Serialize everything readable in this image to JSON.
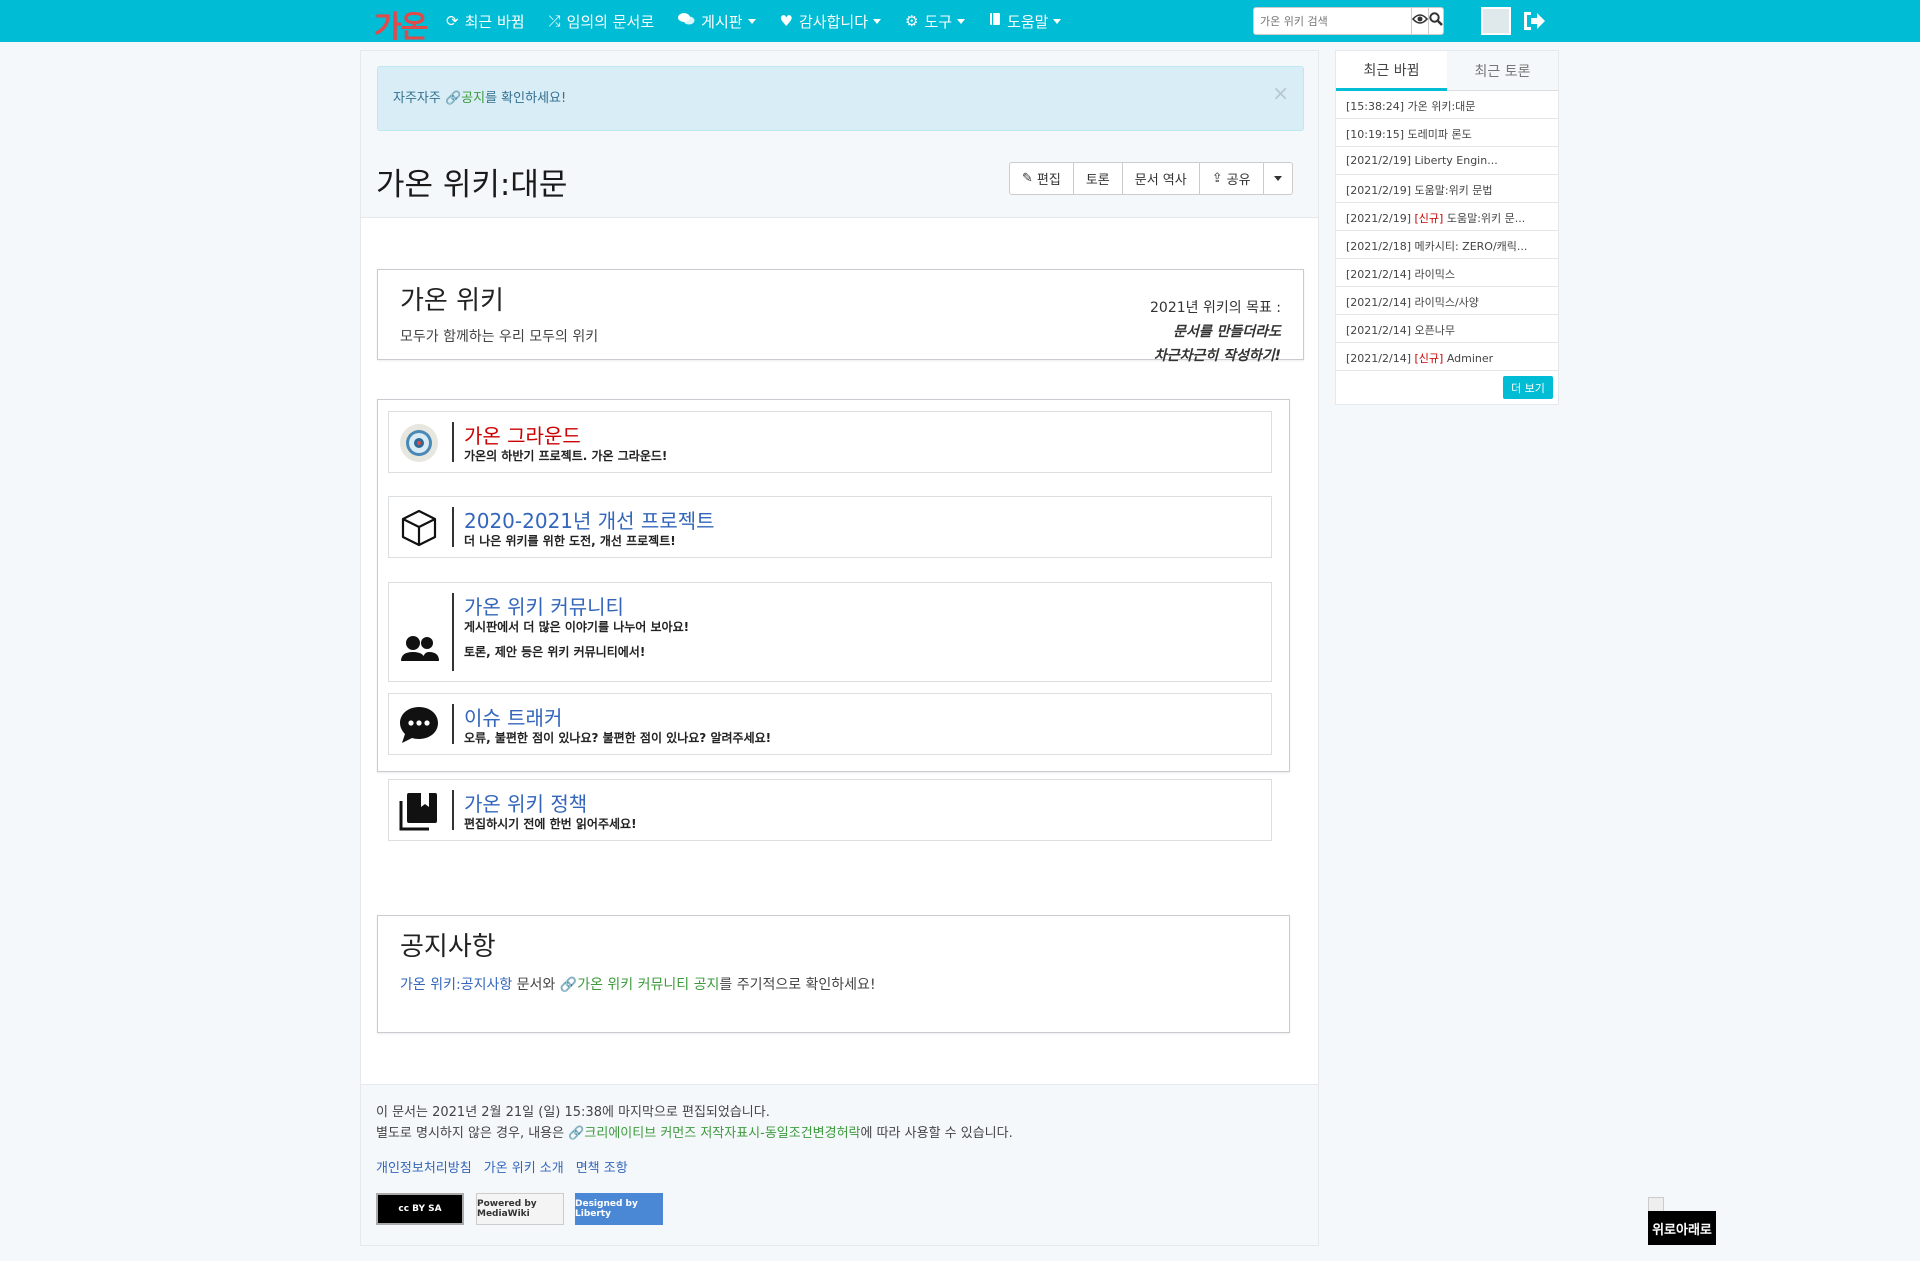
{
  "navbar": {
    "brand": "가온",
    "items": [
      {
        "icon": "refresh-icon",
        "label": "최근 바뀜",
        "dropdown": false
      },
      {
        "icon": "random-icon",
        "label": "임의의 문서로",
        "dropdown": false
      },
      {
        "icon": "comments-icon",
        "label": "게시판",
        "dropdown": true
      },
      {
        "icon": "heart-icon",
        "label": "감사합니다",
        "dropdown": true
      },
      {
        "icon": "gear-icon",
        "label": "도구",
        "dropdown": true
      },
      {
        "icon": "book-icon",
        "label": "도움말",
        "dropdown": true
      }
    ],
    "search_placeholder": "가온 위키 검색"
  },
  "alert": {
    "prefix": "자주자주 ",
    "link": "공지",
    "suffix": "를 확인하세요!",
    "close": "×"
  },
  "page": {
    "title": "가온 위키:대문",
    "actions": [
      "편집",
      "토론",
      "문서 역사",
      "공유"
    ]
  },
  "intro": {
    "title": "가온 위키",
    "subtitle": "모두가 함께하는 우리 모두의 위키",
    "goal_label": "2021년 위키의 목표 :",
    "goal_line1": "문서를 만들더라도",
    "goal_line2": "차근차근히 작성하기!"
  },
  "cards": [
    {
      "title": "가온 그라운드",
      "desc1": "가온의 하반기 프로젝트. 가온 그라운드!",
      "desc2": ""
    },
    {
      "title": "2020-2021년 개선 프로젝트",
      "desc1": "더 나은 위키를 위한 도전, 개선 프로젝트!",
      "desc2": ""
    },
    {
      "title": "가온 위키 커뮤니티",
      "desc1": "게시판에서 더 많은 이야기를 나누어 보아요!",
      "desc2": "토론, 제안 등은 위키 커뮤니티에서!"
    },
    {
      "title": "이슈 트래커",
      "desc1": "오류, 불편한 점이 있나요? 불편한 점이 있나요? 알려주세요!",
      "desc2": ""
    },
    {
      "title": "가온 위키 정책",
      "desc1": "편집하시기 전에 한번 읽어주세요!",
      "desc2": ""
    }
  ],
  "notice": {
    "title": "공지사항",
    "link1": "가온 위키:공지사항",
    "mid": " 문서와 ",
    "link2": "가온 위키 커뮤니티 공지",
    "suffix": "를 주기적으로 확인하세요!"
  },
  "footer": {
    "edited": "이 문서는 2021년 2월 21일 (일) 15:38에 마지막으로 편집되었습니다.",
    "license_prefix": "별도로 명시하지 않은 경우, 내용은 ",
    "license_link": "크리에이티브 커먼즈 저작자표시-동일조건변경허락",
    "license_suffix": "에 따라 사용할 수 있습니다.",
    "links": [
      "개인정보처리방침",
      "가온 위키 소개",
      "면책 조항"
    ],
    "badges": [
      "cc BY SA",
      "Powered by MediaWiki",
      "Designed by Liberty"
    ]
  },
  "sidebar": {
    "tabs": [
      "최근 바뀜",
      "최근 토론"
    ],
    "items": [
      {
        "time": "[15:38:24]",
        "tag": "",
        "title": "가온 위키:대문"
      },
      {
        "time": "[10:19:15]",
        "tag": "",
        "title": "도레미파 론도"
      },
      {
        "time": "[2021/2/19]",
        "tag": "",
        "title": "Liberty Engin..."
      },
      {
        "time": "[2021/2/19]",
        "tag": "",
        "title": "도움말:위키 문법"
      },
      {
        "time": "[2021/2/19]",
        "tag": "[신규]",
        "title": "도움말:위키 문..."
      },
      {
        "time": "[2021/2/18]",
        "tag": "",
        "title": "메카시티: ZERO/캐릭..."
      },
      {
        "time": "[2021/2/14]",
        "tag": "",
        "title": "라이믹스"
      },
      {
        "time": "[2021/2/14]",
        "tag": "",
        "title": "라이믹스/사양"
      },
      {
        "time": "[2021/2/14]",
        "tag": "",
        "title": "오픈나무"
      },
      {
        "time": "[2021/2/14]",
        "tag": "[신규]",
        "title": "Adminer"
      }
    ],
    "more": "더 보기"
  },
  "scroll_button": "위로아래로",
  "colors": {
    "accent": "#00bcd4",
    "brand": "#e04a4a",
    "link": "#3366bb",
    "external_link": "#3c9a3c",
    "new_tag": "#cc0000"
  }
}
